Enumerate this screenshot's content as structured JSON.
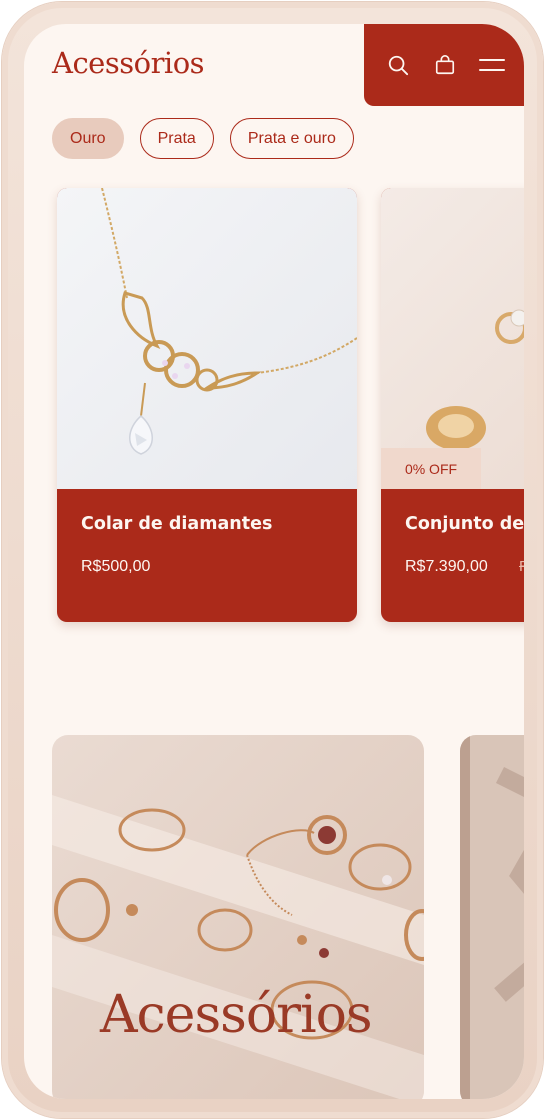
{
  "header": {
    "title": "Acessórios",
    "icons": [
      "search-icon",
      "shopping-bag-icon",
      "menu-icon"
    ]
  },
  "filters": [
    {
      "label": "Ouro",
      "active": true
    },
    {
      "label": "Prata",
      "active": false
    },
    {
      "label": "Prata e ouro",
      "active": false
    }
  ],
  "products": [
    {
      "name": "Colar de diamantes",
      "price": "R$500,00",
      "badge": "",
      "old_price": ""
    },
    {
      "name": "Conjunto de",
      "price": "R$7.390,00",
      "badge": "0% OFF",
      "old_price": "R"
    }
  ],
  "banner": {
    "title": "Acessórios"
  },
  "colors": {
    "brand": "#ab2a1a",
    "background": "#fdf6f1",
    "chip_active": "#e8cbbd"
  }
}
